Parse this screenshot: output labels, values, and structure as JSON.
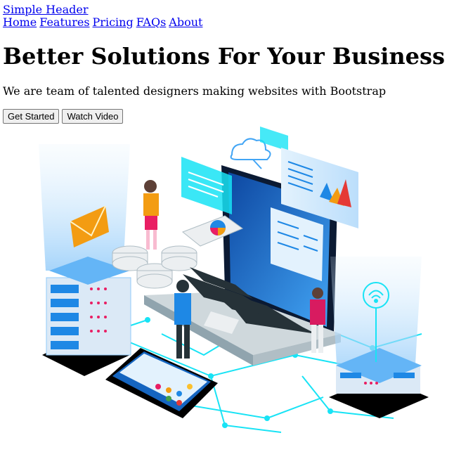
{
  "header": {
    "brand": "Simple Header",
    "nav": [
      "Home",
      "Features",
      "Pricing",
      "FAQs",
      "About"
    ]
  },
  "hero": {
    "title": "Better Solutions For Your Business",
    "subtitle": "We are team of talented designers making websites with Bootstrap",
    "buttons": {
      "get_started": "Get Started",
      "watch_video": "Watch Video"
    }
  },
  "colors": {
    "link": "#0000EE",
    "accent_blue": "#1565c0",
    "light_blue": "#64b5f6",
    "cyan": "#00e5ff",
    "orange": "#f39c12",
    "magenta": "#d81b60"
  },
  "icons": [
    "envelope-icon",
    "cloud-icon",
    "wifi-icon",
    "chart-icon"
  ]
}
